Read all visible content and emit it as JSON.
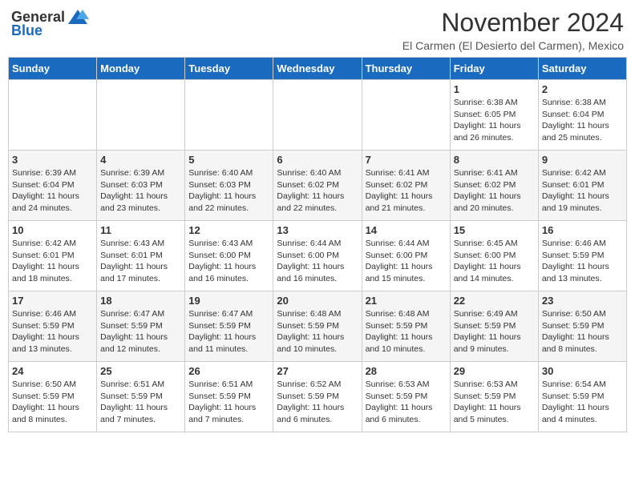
{
  "header": {
    "logo_general": "General",
    "logo_blue": "Blue",
    "month_title": "November 2024",
    "location": "El Carmen (El Desierto del Carmen), Mexico"
  },
  "weekdays": [
    "Sunday",
    "Monday",
    "Tuesday",
    "Wednesday",
    "Thursday",
    "Friday",
    "Saturday"
  ],
  "weeks": [
    [
      {
        "day": "",
        "info": ""
      },
      {
        "day": "",
        "info": ""
      },
      {
        "day": "",
        "info": ""
      },
      {
        "day": "",
        "info": ""
      },
      {
        "day": "",
        "info": ""
      },
      {
        "day": "1",
        "info": "Sunrise: 6:38 AM\nSunset: 6:05 PM\nDaylight: 11 hours and 26 minutes."
      },
      {
        "day": "2",
        "info": "Sunrise: 6:38 AM\nSunset: 6:04 PM\nDaylight: 11 hours and 25 minutes."
      }
    ],
    [
      {
        "day": "3",
        "info": "Sunrise: 6:39 AM\nSunset: 6:04 PM\nDaylight: 11 hours and 24 minutes."
      },
      {
        "day": "4",
        "info": "Sunrise: 6:39 AM\nSunset: 6:03 PM\nDaylight: 11 hours and 23 minutes."
      },
      {
        "day": "5",
        "info": "Sunrise: 6:40 AM\nSunset: 6:03 PM\nDaylight: 11 hours and 22 minutes."
      },
      {
        "day": "6",
        "info": "Sunrise: 6:40 AM\nSunset: 6:02 PM\nDaylight: 11 hours and 22 minutes."
      },
      {
        "day": "7",
        "info": "Sunrise: 6:41 AM\nSunset: 6:02 PM\nDaylight: 11 hours and 21 minutes."
      },
      {
        "day": "8",
        "info": "Sunrise: 6:41 AM\nSunset: 6:02 PM\nDaylight: 11 hours and 20 minutes."
      },
      {
        "day": "9",
        "info": "Sunrise: 6:42 AM\nSunset: 6:01 PM\nDaylight: 11 hours and 19 minutes."
      }
    ],
    [
      {
        "day": "10",
        "info": "Sunrise: 6:42 AM\nSunset: 6:01 PM\nDaylight: 11 hours and 18 minutes."
      },
      {
        "day": "11",
        "info": "Sunrise: 6:43 AM\nSunset: 6:01 PM\nDaylight: 11 hours and 17 minutes."
      },
      {
        "day": "12",
        "info": "Sunrise: 6:43 AM\nSunset: 6:00 PM\nDaylight: 11 hours and 16 minutes."
      },
      {
        "day": "13",
        "info": "Sunrise: 6:44 AM\nSunset: 6:00 PM\nDaylight: 11 hours and 16 minutes."
      },
      {
        "day": "14",
        "info": "Sunrise: 6:44 AM\nSunset: 6:00 PM\nDaylight: 11 hours and 15 minutes."
      },
      {
        "day": "15",
        "info": "Sunrise: 6:45 AM\nSunset: 6:00 PM\nDaylight: 11 hours and 14 minutes."
      },
      {
        "day": "16",
        "info": "Sunrise: 6:46 AM\nSunset: 5:59 PM\nDaylight: 11 hours and 13 minutes."
      }
    ],
    [
      {
        "day": "17",
        "info": "Sunrise: 6:46 AM\nSunset: 5:59 PM\nDaylight: 11 hours and 13 minutes."
      },
      {
        "day": "18",
        "info": "Sunrise: 6:47 AM\nSunset: 5:59 PM\nDaylight: 11 hours and 12 minutes."
      },
      {
        "day": "19",
        "info": "Sunrise: 6:47 AM\nSunset: 5:59 PM\nDaylight: 11 hours and 11 minutes."
      },
      {
        "day": "20",
        "info": "Sunrise: 6:48 AM\nSunset: 5:59 PM\nDaylight: 11 hours and 10 minutes."
      },
      {
        "day": "21",
        "info": "Sunrise: 6:48 AM\nSunset: 5:59 PM\nDaylight: 11 hours and 10 minutes."
      },
      {
        "day": "22",
        "info": "Sunrise: 6:49 AM\nSunset: 5:59 PM\nDaylight: 11 hours and 9 minutes."
      },
      {
        "day": "23",
        "info": "Sunrise: 6:50 AM\nSunset: 5:59 PM\nDaylight: 11 hours and 8 minutes."
      }
    ],
    [
      {
        "day": "24",
        "info": "Sunrise: 6:50 AM\nSunset: 5:59 PM\nDaylight: 11 hours and 8 minutes."
      },
      {
        "day": "25",
        "info": "Sunrise: 6:51 AM\nSunset: 5:59 PM\nDaylight: 11 hours and 7 minutes."
      },
      {
        "day": "26",
        "info": "Sunrise: 6:51 AM\nSunset: 5:59 PM\nDaylight: 11 hours and 7 minutes."
      },
      {
        "day": "27",
        "info": "Sunrise: 6:52 AM\nSunset: 5:59 PM\nDaylight: 11 hours and 6 minutes."
      },
      {
        "day": "28",
        "info": "Sunrise: 6:53 AM\nSunset: 5:59 PM\nDaylight: 11 hours and 6 minutes."
      },
      {
        "day": "29",
        "info": "Sunrise: 6:53 AM\nSunset: 5:59 PM\nDaylight: 11 hours and 5 minutes."
      },
      {
        "day": "30",
        "info": "Sunrise: 6:54 AM\nSunset: 5:59 PM\nDaylight: 11 hours and 4 minutes."
      }
    ]
  ]
}
